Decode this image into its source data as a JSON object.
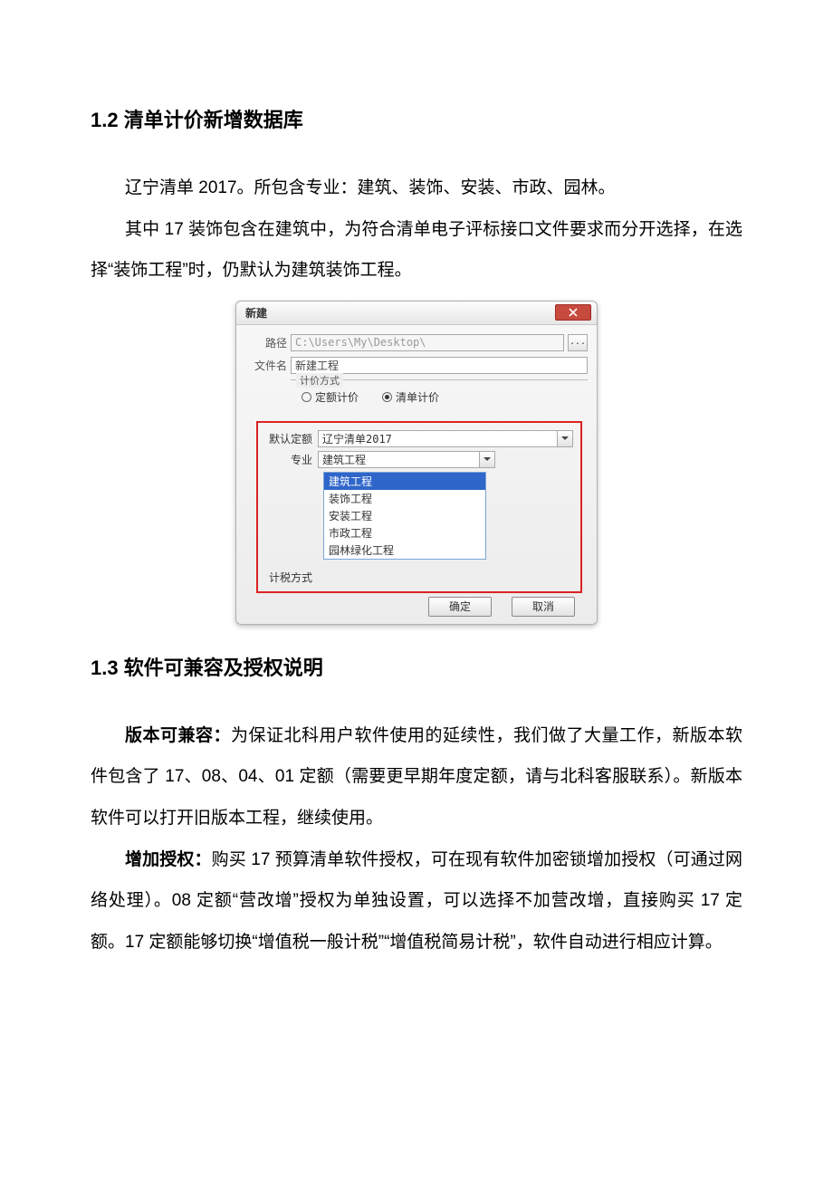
{
  "section12": {
    "heading": "1.2  清单计价新增数据库",
    "para1": "辽宁清单 2017。所包含专业：建筑、装饰、安装、市政、园林。",
    "para2": "其中 17 装饰包含在建筑中，为符合清单电子评标接口文件要求而分开选择，在选择“装饰工程”时，仍默认为建筑装饰工程。"
  },
  "dialog": {
    "title": "新建",
    "path_label": "路径",
    "path_value": "C:\\Users\\My\\Desktop\\",
    "filename_label": "文件名",
    "filename_value": "新建工程",
    "pricing_legend": "计价方式",
    "radio_quota": "定额计价",
    "radio_list": "清单计价",
    "default_quota_label": "默认定额",
    "default_quota_value": "辽宁清单2017",
    "specialty_label": "专业",
    "specialty_value": "建筑工程",
    "tax_label": "计税方式",
    "dropdown": [
      "建筑工程",
      "装饰工程",
      "安装工程",
      "市政工程",
      "园林绿化工程"
    ],
    "ok": "确定",
    "cancel": "取消"
  },
  "section13": {
    "heading": "1.3  软件可兼容及授权说明",
    "para1_bold": "版本可兼容：",
    "para1": "为保证北科用户软件使用的延续性，我们做了大量工作，新版本软件包含了 17、08、04、01 定额（需要更早期年度定额，请与北科客服联系）。新版本软件可以打开旧版本工程，继续使用。",
    "para2_bold": "增加授权：",
    "para2": "购买 17 预算清单软件授权，可在现有软件加密锁增加授权（可通过网络处理）。08 定额“营改增”授权为单独设置，可以选择不加营改增，直接购买 17 定额。17 定额能够切换“增值税一般计税”“增值税简易计税”，软件自动进行相应计算。"
  }
}
